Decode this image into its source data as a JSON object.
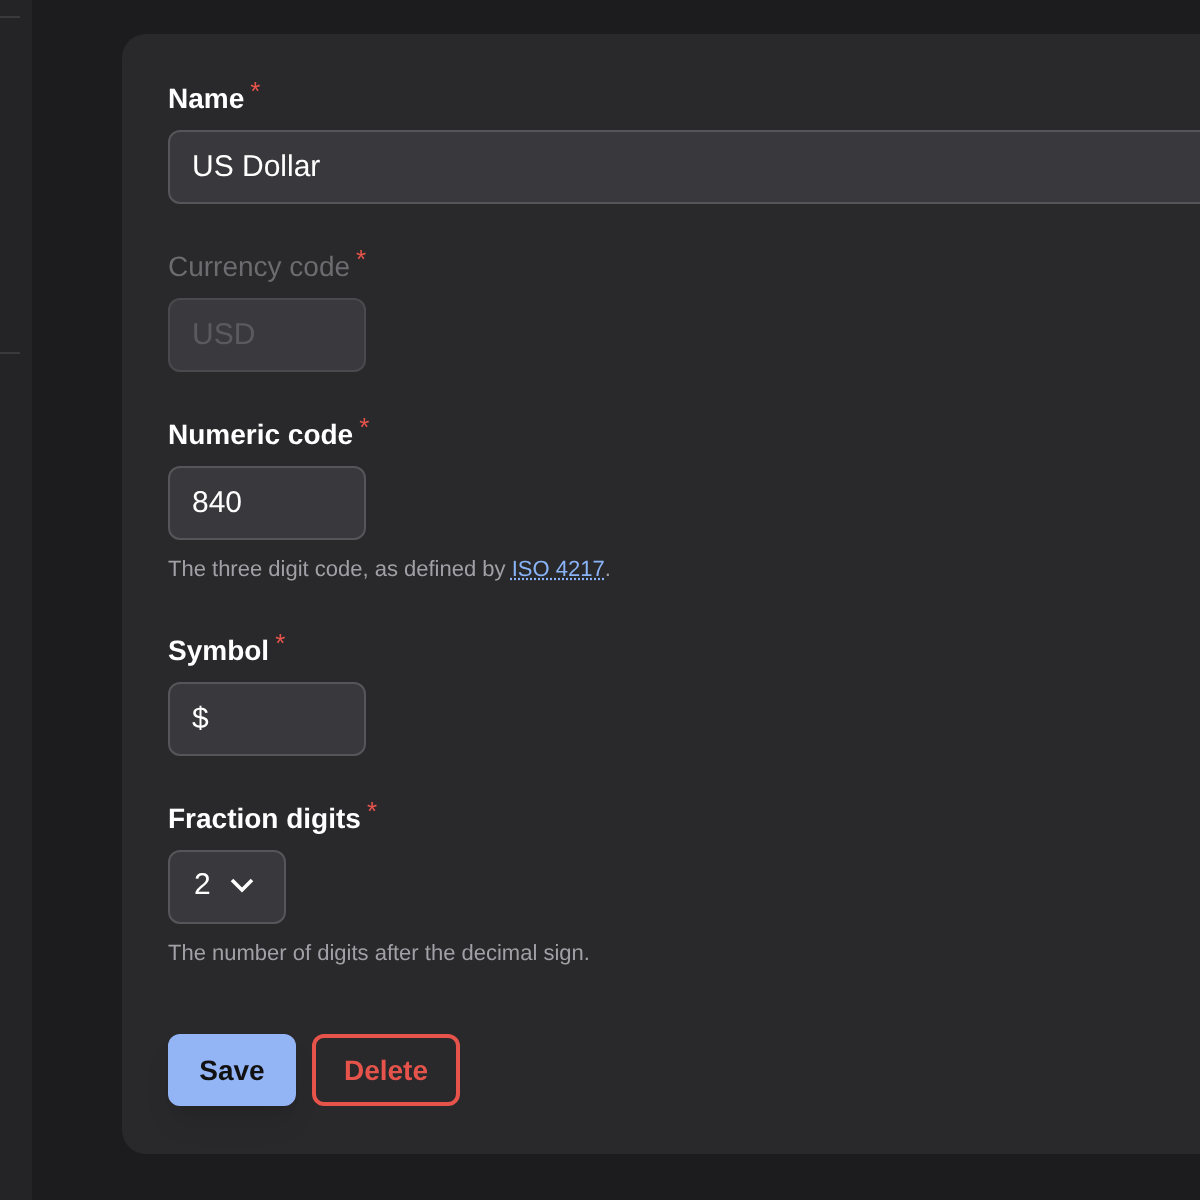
{
  "form": {
    "fields": [
      {
        "kind": "text",
        "label": "Name",
        "required_mark": "*",
        "disabled": false,
        "value": "US Dollar",
        "wide": true
      },
      {
        "kind": "text",
        "label": "Currency code",
        "required_mark": "*",
        "disabled": true,
        "value": "USD",
        "wide": false
      },
      {
        "kind": "text",
        "label": "Numeric code",
        "required_mark": "*",
        "disabled": false,
        "value": "840",
        "wide": false,
        "help": "The three digit code, as defined by ",
        "help_link": "ISO 4217",
        "help_after": "."
      },
      {
        "kind": "text",
        "label": "Symbol",
        "required_mark": "*",
        "disabled": false,
        "value": "$",
        "wide": false
      },
      {
        "kind": "select",
        "label": "Fraction digits",
        "required_mark": "*",
        "disabled": false,
        "value": "2",
        "help": "The number of digits after the decimal sign."
      }
    ],
    "buttons": [
      {
        "kind": "primary",
        "label": "Save"
      },
      {
        "kind": "danger",
        "label": "Delete"
      }
    ]
  }
}
